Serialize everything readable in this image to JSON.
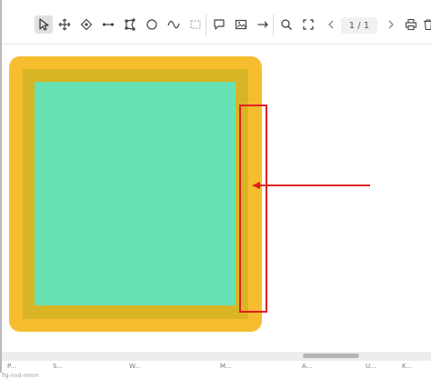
{
  "toolbar": {
    "tools": [
      {
        "name": "select-tool",
        "icon": "cursor-icon",
        "active": true
      },
      {
        "name": "move-tool",
        "icon": "move-arrows-icon"
      },
      {
        "name": "point-tool",
        "icon": "diamond-point-icon"
      },
      {
        "name": "line-tool",
        "icon": "line-segment-icon"
      },
      {
        "name": "polygon-tool",
        "icon": "polygon-icon"
      },
      {
        "name": "ellipse-tool",
        "icon": "circle-icon"
      },
      {
        "name": "freehand-tool",
        "icon": "wave-icon"
      },
      {
        "name": "rectangle-tool",
        "icon": "dashed-rectangle-icon"
      },
      {
        "name": "comment-tool",
        "icon": "speech-bubble-icon"
      },
      {
        "name": "image-tool",
        "icon": "image-icon"
      },
      {
        "name": "arrow-tool",
        "icon": "arrow-right-icon"
      },
      {
        "name": "zoom-tool",
        "icon": "magnifier-icon"
      },
      {
        "name": "fit-view-tool",
        "icon": "fullscreen-corners-icon"
      }
    ],
    "page_indicator": "1 / 1",
    "print_icon": "printer-icon",
    "delete_icon": "trash-icon"
  },
  "drawing": {
    "outer_color": "#f6bd2f",
    "inner_border_color": "#d9b525",
    "fill_color": "#67e2b5",
    "highlight_box_color": "#e02020",
    "arrow_color": "#e02020"
  },
  "scrollbar": {
    "horizontal": true
  },
  "bottom_tabs": [
    "P...",
    "S...",
    "W...",
    "M...",
    "A...",
    "U...",
    "K..."
  ],
  "footnote": "fig-nnd-mmm"
}
